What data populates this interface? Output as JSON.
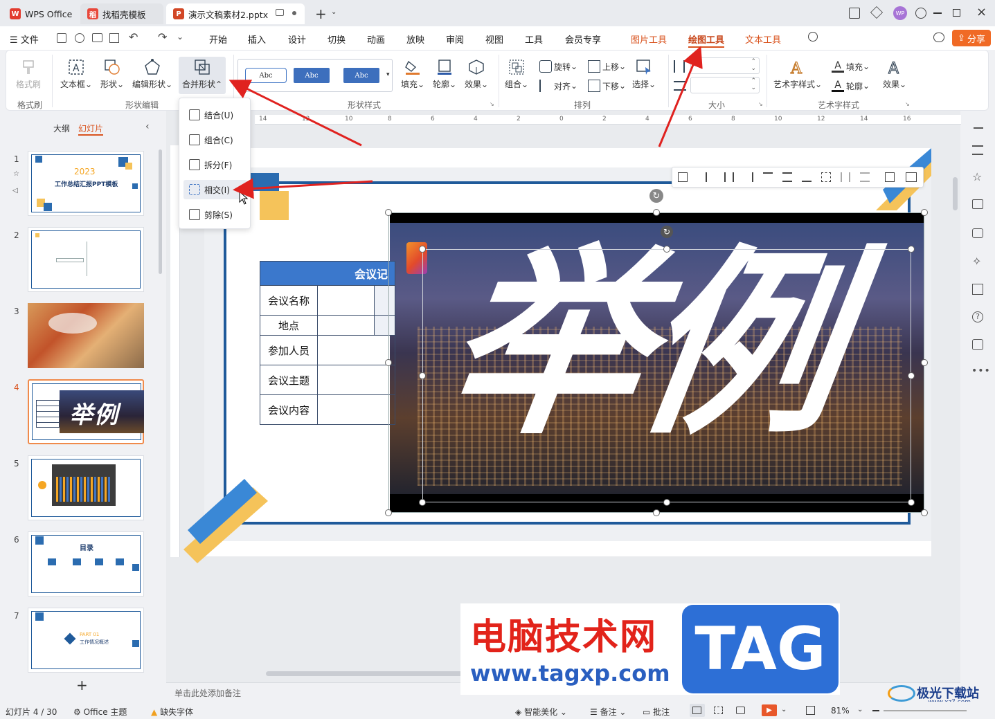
{
  "titlebar": {
    "tabs": [
      {
        "label": "WPS Office"
      },
      {
        "label": "找稻壳模板"
      },
      {
        "label": "演示文稿素材2.pptx"
      }
    ],
    "avatar": "WP"
  },
  "menubar": {
    "file": "文件",
    "items": [
      "开始",
      "插入",
      "设计",
      "切换",
      "动画",
      "放映",
      "审阅",
      "视图",
      "工具",
      "会员专享"
    ],
    "context_tabs": [
      "图片工具",
      "绘图工具",
      "文本工具"
    ],
    "share": "分享"
  },
  "ribbon": {
    "format_brush": "格式刷",
    "group_format": "格式刷",
    "textbox": "文本框",
    "shape": "形状",
    "edit_shape": "编辑形状",
    "merge_shape": "合并形状",
    "group_shape_edit": "形状编辑",
    "style_samples": [
      "Abc",
      "Abc",
      "Abc"
    ],
    "group_shape_style": "形状样式",
    "fill": "填充",
    "outline": "轮廓",
    "effect": "效果",
    "combine": "组合",
    "rotate": "旋转",
    "align": "对齐",
    "bring_up": "上移",
    "send_down": "下移",
    "select": "选择",
    "group_arrange": "排列",
    "group_size": "大小",
    "art_style": "艺术字样式",
    "text_fill": "填充",
    "text_outline": "轮廓",
    "text_effect": "效果",
    "group_art": "艺术字样式"
  },
  "dropdown": {
    "items": [
      "结合(U)",
      "组合(C)",
      "拆分(F)",
      "相交(I)",
      "剪除(S)"
    ]
  },
  "leftpanel": {
    "tabs": [
      "大纲",
      "幻灯片"
    ],
    "slides": [
      "1",
      "2",
      "3",
      "4",
      "5",
      "6",
      "7"
    ],
    "add": "+",
    "slide1_year": "2023",
    "slide1_title": "工作总结汇报PPT模板",
    "slide4_text": "举例",
    "slide6_title": "目录",
    "slide7_part": "PART 01",
    "slide7_sub": "工作情况概述"
  },
  "ruler": {
    "labels": [
      "14",
      "12",
      "10",
      "8",
      "6",
      "4",
      "2",
      "0",
      "2",
      "4",
      "6",
      "8",
      "10",
      "12",
      "14",
      "16"
    ]
  },
  "slide": {
    "table_header": "会议记",
    "rows": [
      "会议名称",
      "地点",
      "参加人员",
      "会议主题",
      "会议内容"
    ],
    "art_text": "举例"
  },
  "notes": "单击此处添加备注",
  "watermark": {
    "text1": "电脑技术网",
    "text2": "www.tagxp.com",
    "tag": "TAG",
    "logo": "极光下载站",
    "logo_url": "www.xz7.com"
  },
  "statusbar": {
    "slide_pos": "幻灯片 4 / 30",
    "theme": "Office 主题",
    "missing_font": "缺失字体",
    "beautify": "智能美化",
    "notes": "备注",
    "comments": "批注",
    "zoom": "81%"
  },
  "colors": {
    "accent": "#d9531e",
    "brand_blue": "#1f5a9a",
    "yellow": "#f5c35a"
  }
}
